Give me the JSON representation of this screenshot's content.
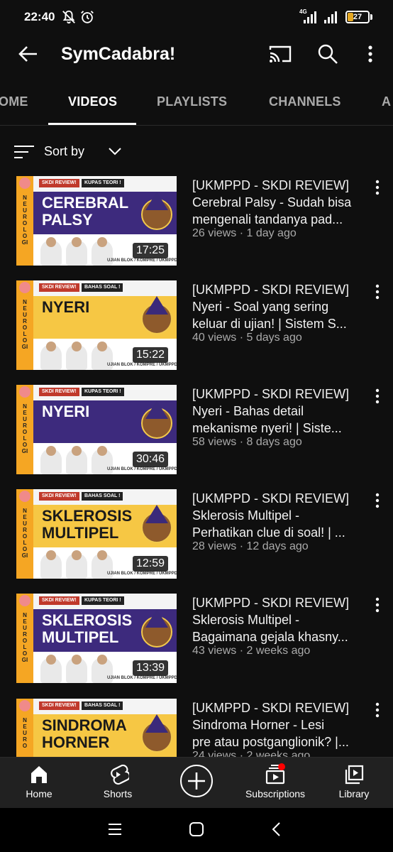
{
  "status_bar": {
    "time": "22:40",
    "network": "4G",
    "battery": "27",
    "battery_fraction": 0.27,
    "battery_color": "#e5a823",
    "icons": [
      "muted-bell-icon",
      "alarm-icon",
      "signal-icon",
      "signal-icon",
      "battery-icon"
    ]
  },
  "app_bar": {
    "title": "SymCadabra!",
    "icons": [
      "back-arrow-icon",
      "cast-icon",
      "search-icon",
      "more-vert-icon"
    ]
  },
  "tabs": {
    "items": [
      {
        "label": "OME"
      },
      {
        "label": "VIDEOS",
        "active": true
      },
      {
        "label": "PLAYLISTS"
      },
      {
        "label": "CHANNELS"
      },
      {
        "label": "A"
      }
    ]
  },
  "sort": {
    "label": "Sort by"
  },
  "videos": [
    {
      "thumb_title": "CEREBRAL PALSY",
      "thumb_tag": "SKDI REVIEW!",
      "thumb_tag2": "KUPAS TEORI !",
      "thumb_band_color": "#3d2a7d",
      "thumb_side": "NEUROLOGI",
      "thumb_footer": "UJIAN BLOK / KOMPRE / UKMPPD",
      "duration": "17:25",
      "title_line1": "[UKMPPD - SKDI REVIEW]",
      "title_line2": "Cerebral Palsy - Sudah bisa",
      "title_line3": "mengenali tandanya pad...",
      "meta": "26 views · 1 day ago"
    },
    {
      "thumb_title": "NYERI",
      "thumb_tag": "SKDI REVIEW!",
      "thumb_tag2": "BAHAS SOAL !",
      "thumb_band_color": "#f6c744",
      "thumb_side": "NEUROLOGI",
      "thumb_footer": "UJIAN BLOK / KOMPRE / UKMPPD",
      "duration": "15:22",
      "title_line1": "[UKMPPD - SKDI REVIEW]",
      "title_line2": "Nyeri - Soal yang sering",
      "title_line3": "keluar di ujian! | Sistem S...",
      "meta": "40 views · 5 days ago"
    },
    {
      "thumb_title": "NYERI",
      "thumb_tag": "SKDI REVIEW!",
      "thumb_tag2": "KUPAS TEORI !",
      "thumb_band_color": "#3d2a7d",
      "thumb_side": "NEUROLOGI",
      "thumb_footer": "UJIAN BLOK / KOMPRE / UKMPPD",
      "duration": "30:46",
      "title_line1": "[UKMPPD - SKDI REVIEW]",
      "title_line2": "Nyeri - Bahas detail",
      "title_line3": "mekanisme nyeri! | Siste...",
      "meta": "58 views · 8 days ago"
    },
    {
      "thumb_title": "SKLEROSIS MULTIPEL",
      "thumb_tag": "SKDI REVIEW!",
      "thumb_tag2": "BAHAS SOAL !",
      "thumb_band_color": "#f6c744",
      "thumb_side": "NEUROLOGI",
      "thumb_footer": "UJIAN BLOK / KOMPRE / UKMPPD",
      "duration": "12:59",
      "title_line1": "[UKMPPD - SKDI REVIEW]",
      "title_line2": "Sklerosis Multipel -",
      "title_line3": "Perhatikan clue di soal! | ...",
      "meta": "28 views · 12 days ago"
    },
    {
      "thumb_title": "SKLEROSIS MULTIPEL",
      "thumb_tag": "SKDI REVIEW!",
      "thumb_tag2": "KUPAS TEORI !",
      "thumb_band_color": "#3d2a7d",
      "thumb_side": "NEUROLOGI",
      "thumb_footer": "UJIAN BLOK / KOMPRE / UKMPPD",
      "duration": "13:39",
      "title_line1": "[UKMPPD - SKDI REVIEW]",
      "title_line2": "Sklerosis Multipel -",
      "title_line3": "Bagaimana gejala khasny...",
      "meta": "43 views · 2 weeks ago"
    },
    {
      "thumb_title": "SINDROMA HORNER",
      "thumb_tag": "SKDI REVIEW!",
      "thumb_tag2": "BAHAS SOAL !",
      "thumb_band_color": "#f6c744",
      "thumb_side": "NEURO",
      "thumb_footer": "",
      "duration": "",
      "title_line1": "[UKMPPD - SKDI REVIEW]",
      "title_line2": "Sindroma Horner - Lesi",
      "title_line3": "pre atau postganglionik? |...",
      "meta": "24 views · 2 weeks ago"
    }
  ],
  "bottom_nav": {
    "items": [
      {
        "label": "Home",
        "icon": "home-icon",
        "active": true
      },
      {
        "label": "Shorts",
        "icon": "shorts-icon"
      },
      {
        "label": "",
        "icon": "create-plus-icon"
      },
      {
        "label": "Subscriptions",
        "icon": "subscriptions-icon",
        "has_notification": true
      },
      {
        "label": "Library",
        "icon": "library-icon"
      }
    ]
  },
  "system_nav": {
    "icons": [
      "recent-apps-icon",
      "home-circle-icon",
      "back-chevron-icon"
    ]
  }
}
